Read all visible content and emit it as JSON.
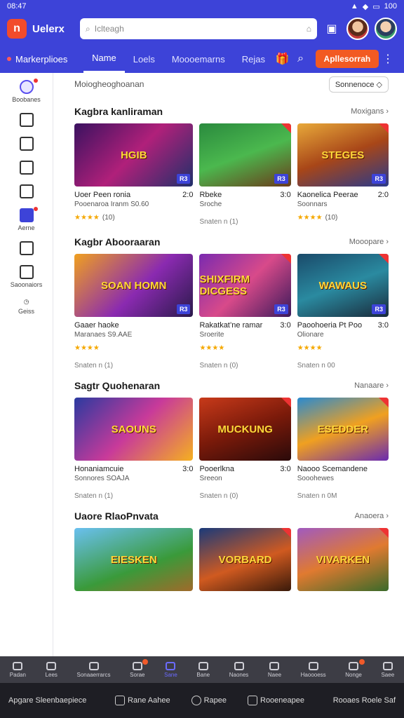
{
  "status": {
    "time": "08:47",
    "battery": "100"
  },
  "app": {
    "brand": "Uelerx",
    "search_placeholder": "Iclteagh"
  },
  "nav": {
    "marketplace": "Markerplioes",
    "tabs": [
      "Name",
      "Loels",
      "Moooemarns",
      "Rejas"
    ],
    "cta": "Apllesorrah"
  },
  "sidebar": {
    "items": [
      {
        "label": "Boobanes",
        "icon": "user-circle-icon"
      },
      {
        "label": "",
        "icon": "book-icon"
      },
      {
        "label": "",
        "icon": "note-icon"
      },
      {
        "label": "",
        "icon": "bell-icon"
      },
      {
        "label": "",
        "icon": "message-icon"
      },
      {
        "label": "Aerne",
        "icon": "cart-icon"
      },
      {
        "label": "",
        "icon": "grid-icon"
      },
      {
        "label": "Saoonaiors",
        "icon": "panel-icon"
      },
      {
        "label": "Geiss",
        "icon": "clock-icon"
      }
    ]
  },
  "main": {
    "top_label": "Moiogheoghoanan",
    "sort_label": "Sonnenoce",
    "sections": [
      {
        "title": "Kagbra kanliraman",
        "more": "Moxigans",
        "cards": [
          {
            "art": "HGIB",
            "badge": "R3",
            "title": "Uoer Peen ronia",
            "price": "2:0",
            "sub": "Pooenaroa Iranm",
            "sub2": "S0.60",
            "stars": "★★★★",
            "count": "(10)"
          },
          {
            "art": "",
            "badge": "R3",
            "title": "Rbeke",
            "price": "3:0",
            "sub": "Sroche",
            "sub2": "",
            "stars": "",
            "count": "",
            "meta": "Snaten  n  (1)"
          },
          {
            "art": "STEGES",
            "badge": "R3",
            "title": "Kaonelica Peerae",
            "price": "2:0",
            "sub": "Soonnars",
            "sub2": "",
            "stars": "★★★★",
            "count": "(10)"
          }
        ]
      },
      {
        "title": "Kagbr Abooraaran",
        "more": "Mooopare",
        "cards": [
          {
            "art": "SOAN HOMN",
            "badge": "R3",
            "title": "Gaaer haoke",
            "price": "",
            "sub": "Maranaes",
            "sub2": "S9.AAE",
            "stars": "★★★★",
            "count": "",
            "meta": "Snaten  n  (1)"
          },
          {
            "art": "SHIXFIRM DICGESS",
            "badge": "R3",
            "title": "Rakatkat’ne ramar",
            "price": "3:0",
            "sub": "Sroerite",
            "sub2": "",
            "stars": "★★★★",
            "count": "",
            "meta": "Snaten  n  (0)"
          },
          {
            "art": "WAWAUS",
            "badge": "R3",
            "title": "Paoohoeria Pt Poo",
            "price": "3:0",
            "sub": "Olionare",
            "sub2": "",
            "stars": "★★★★",
            "count": "",
            "meta": "Snaten  n  00"
          }
        ]
      },
      {
        "title": "Sagtr Quohenaran",
        "more": "Nanaare",
        "cards": [
          {
            "art": "SAOUNS",
            "badge": "",
            "title": "Honaniamcuie",
            "price": "3:0",
            "sub": "Sonnores",
            "sub2": "SOAJA",
            "stars": "",
            "count": "",
            "meta": "Snaten  n  (1)"
          },
          {
            "art": "MUCKUNG",
            "badge": "",
            "title": "Pooerlkna",
            "price": "3:0",
            "sub": "Sreeon",
            "sub2": "",
            "stars": "",
            "count": "",
            "meta": "Snaten  n  (0)"
          },
          {
            "art": "ESEDDER",
            "badge": "",
            "title": "Naooo Scemandene",
            "price": "",
            "sub": "Sooohewes",
            "sub2": "",
            "stars": "",
            "count": "",
            "meta": "Snaten  n  0M"
          }
        ]
      },
      {
        "title": "Uaore RlaoPnvata",
        "more": "Anaoera",
        "cards": [
          {
            "art": "EIESKEN",
            "badge": "",
            "title": "",
            "price": "",
            "sub": "",
            "sub2": "",
            "stars": "",
            "count": ""
          },
          {
            "art": "VORBARD",
            "badge": "",
            "title": "",
            "price": "",
            "sub": "",
            "sub2": "",
            "stars": "",
            "count": ""
          },
          {
            "art": "VIVARKEN",
            "badge": "",
            "title": "",
            "price": "",
            "sub": "",
            "sub2": "",
            "stars": "",
            "count": ""
          }
        ]
      }
    ]
  },
  "bottom_nav": [
    {
      "label": "Padan",
      "icon": "store-icon"
    },
    {
      "label": "Lees",
      "icon": "home-icon"
    },
    {
      "label": "Sonaaerrarcs",
      "icon": "profile-icon"
    },
    {
      "label": "Sorae",
      "icon": "chat-icon"
    },
    {
      "label": "Sane",
      "icon": "search-icon"
    },
    {
      "label": "Bane",
      "icon": "gamepad-icon"
    },
    {
      "label": "Naones",
      "icon": "wand-icon"
    },
    {
      "label": "Naee",
      "icon": "controller-icon"
    },
    {
      "label": "Haoooess",
      "icon": "pin-icon"
    },
    {
      "label": "Nonge",
      "icon": "library-icon"
    },
    {
      "label": "Saee",
      "icon": "person-icon"
    }
  ],
  "system": {
    "left": "Apgare  Sleenbaepiece",
    "mid": [
      "Rane Aahee",
      "Rapee",
      "Rooeneapee"
    ],
    "right": "Rooaes  Roele Saf"
  }
}
